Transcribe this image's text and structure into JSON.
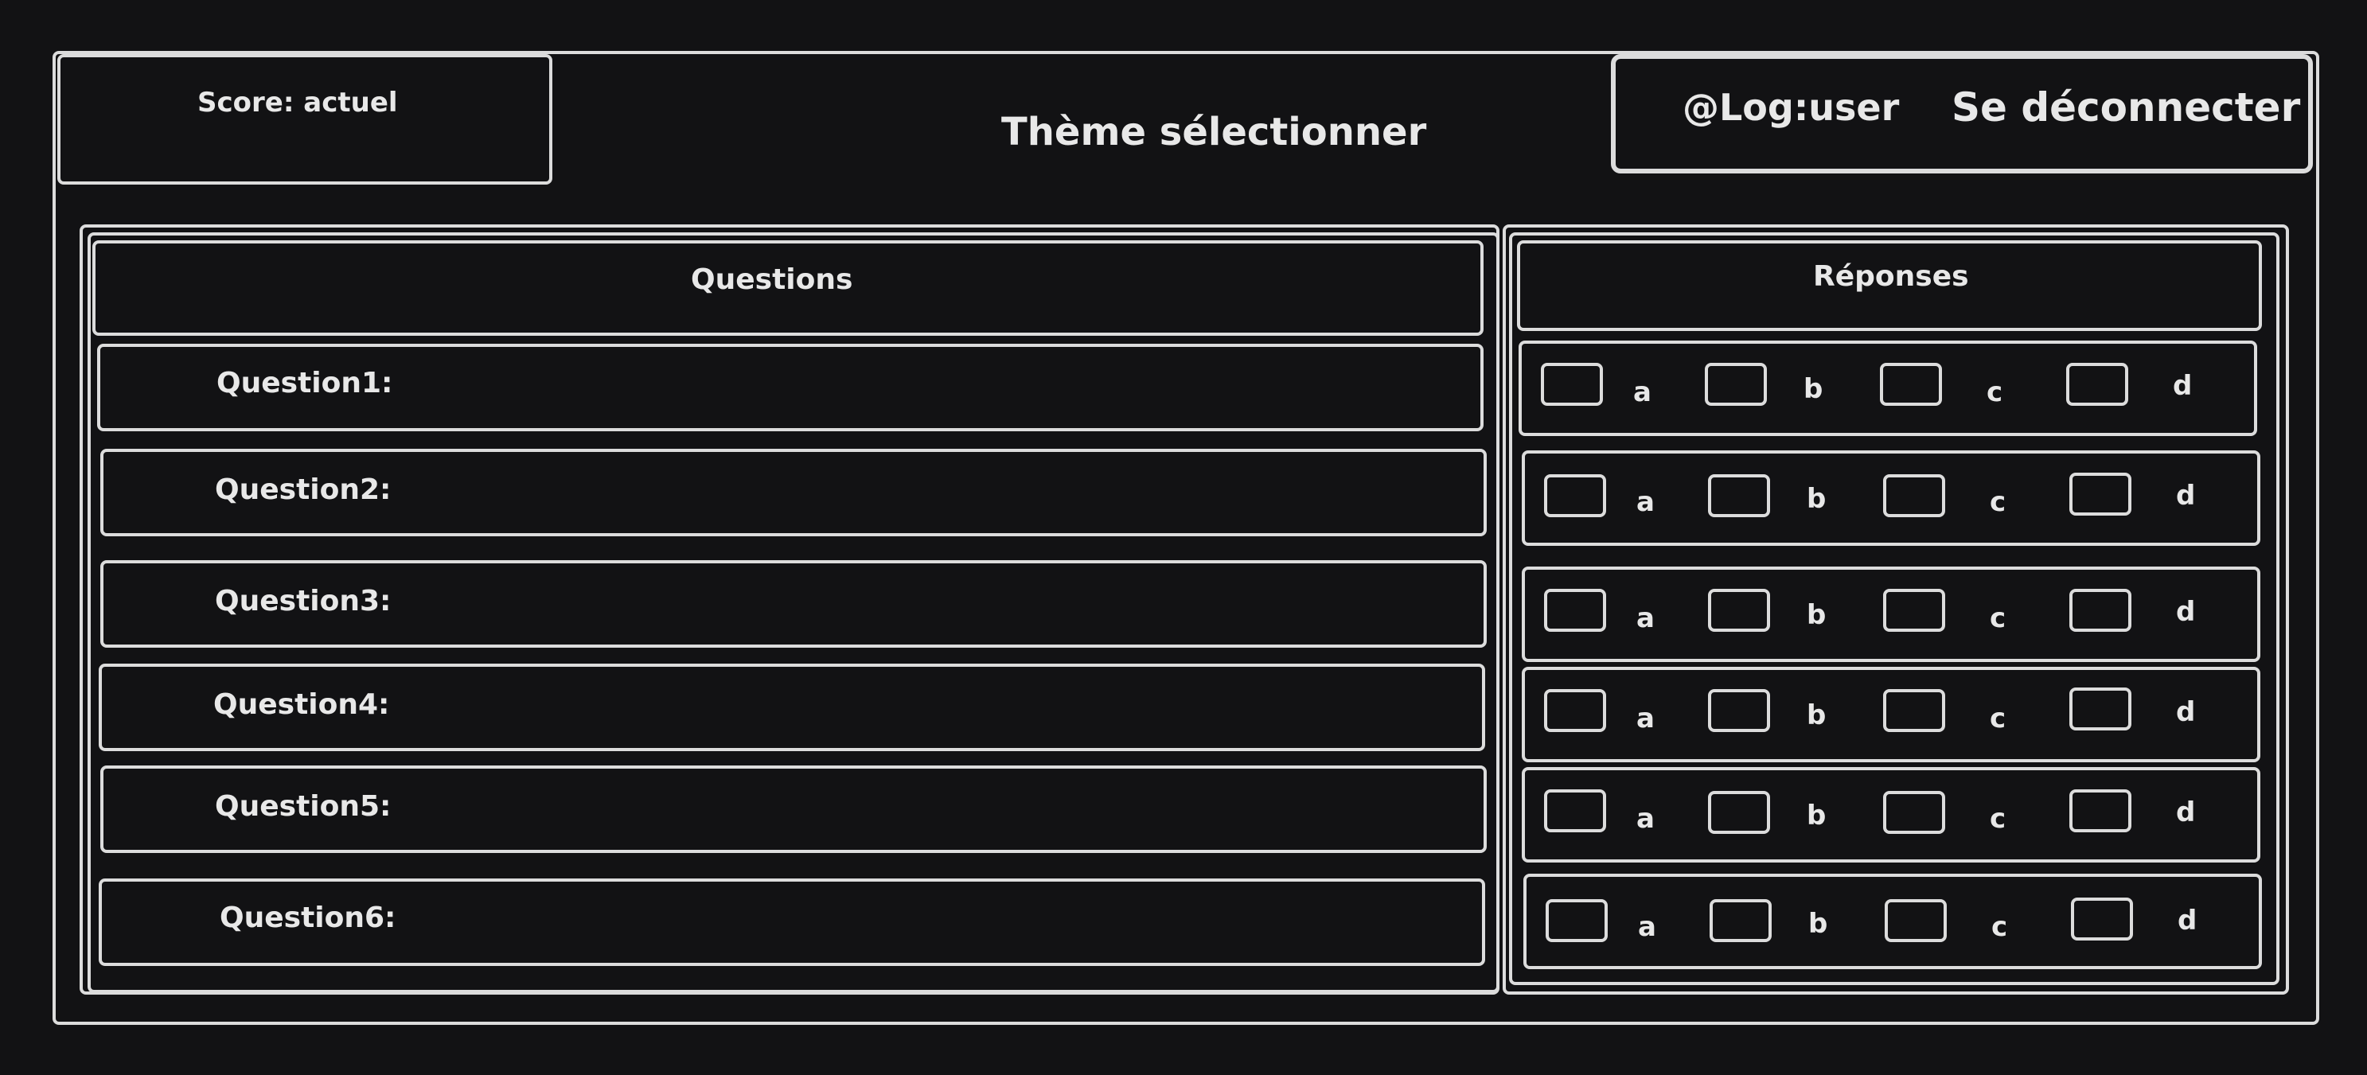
{
  "header": {
    "score_label": "Score: actuel",
    "theme_title": "Thème sélectionner",
    "user_handle": "@Log:user",
    "logout_label": "Se déconnecter"
  },
  "questions_panel": {
    "header": "Questions",
    "items": [
      {
        "label": "Question1:"
      },
      {
        "label": "Question2:"
      },
      {
        "label": "Question3:"
      },
      {
        "label": "Question4:"
      },
      {
        "label": "Question5:"
      },
      {
        "label": "Question6:"
      }
    ]
  },
  "answers_panel": {
    "header": "Réponses",
    "options": [
      "a",
      "b",
      "c",
      "d"
    ]
  }
}
